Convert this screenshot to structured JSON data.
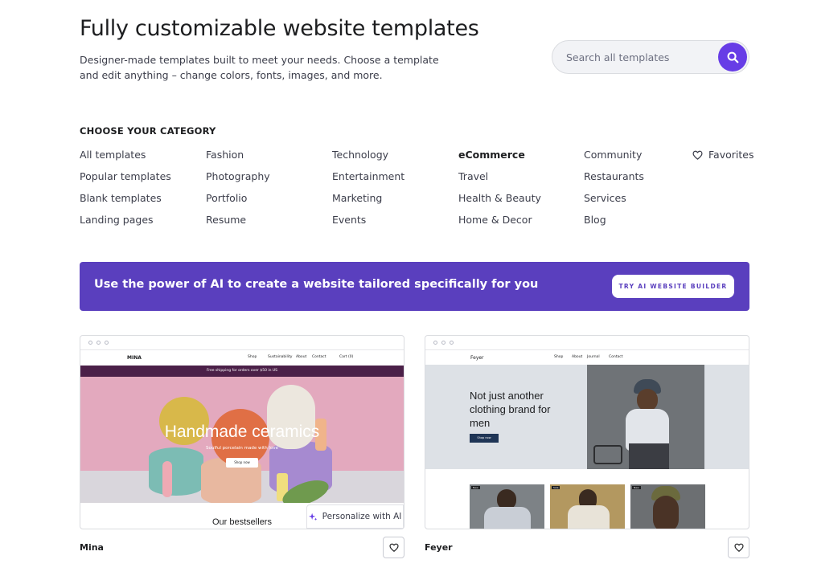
{
  "header": {
    "title": "Fully customizable website templates",
    "subtitle": "Designer-made templates built to meet your needs. Choose a template and edit anything – change colors, fonts, images, and more."
  },
  "search": {
    "placeholder": "Search all templates",
    "icon": "search-icon",
    "accent_color": "#673de6"
  },
  "categories": {
    "heading": "CHOOSE YOUR CATEGORY",
    "columns": [
      [
        "All templates",
        "Popular templates",
        "Blank templates",
        "Landing pages"
      ],
      [
        "Fashion",
        "Photography",
        "Portfolio",
        "Resume"
      ],
      [
        "Technology",
        "Entertainment",
        "Marketing",
        "Events"
      ],
      [
        "eCommerce",
        "Travel",
        "Health & Beauty",
        "Home & Decor"
      ],
      [
        "Community",
        "Restaurants",
        "Services",
        "Blog"
      ]
    ],
    "active": "eCommerce",
    "favorites_label": "Favorites"
  },
  "ai_banner": {
    "text": "Use the power of AI to create a website tailored specifically for you",
    "button_label": "TRY AI WEBSITE BUILDER",
    "color": "#5a3fbe"
  },
  "templates": [
    {
      "name": "Mina",
      "preview": {
        "brand": "MINA",
        "nav": [
          "Shop",
          "Sustainability",
          "About",
          "Contact"
        ],
        "cart": "Cart (0)",
        "promo": "Free shipping for orders over $50 in US",
        "hero_title": "Handmade ceramics",
        "hero_subtitle": "Soulful porcelain made with love",
        "hero_button": "Shop now",
        "section_title": "Our bestsellers"
      },
      "personalize_label": "Personalize with AI"
    },
    {
      "name": "Feyer",
      "preview": {
        "brand": "Feyer",
        "nav": [
          "Shop",
          "About",
          "Journal",
          "Contact"
        ],
        "hero_title": "Not just another clothing brand for men",
        "hero_button": "Shop now",
        "tags": [
          "New",
          "Sale",
          "New"
        ]
      }
    }
  ]
}
